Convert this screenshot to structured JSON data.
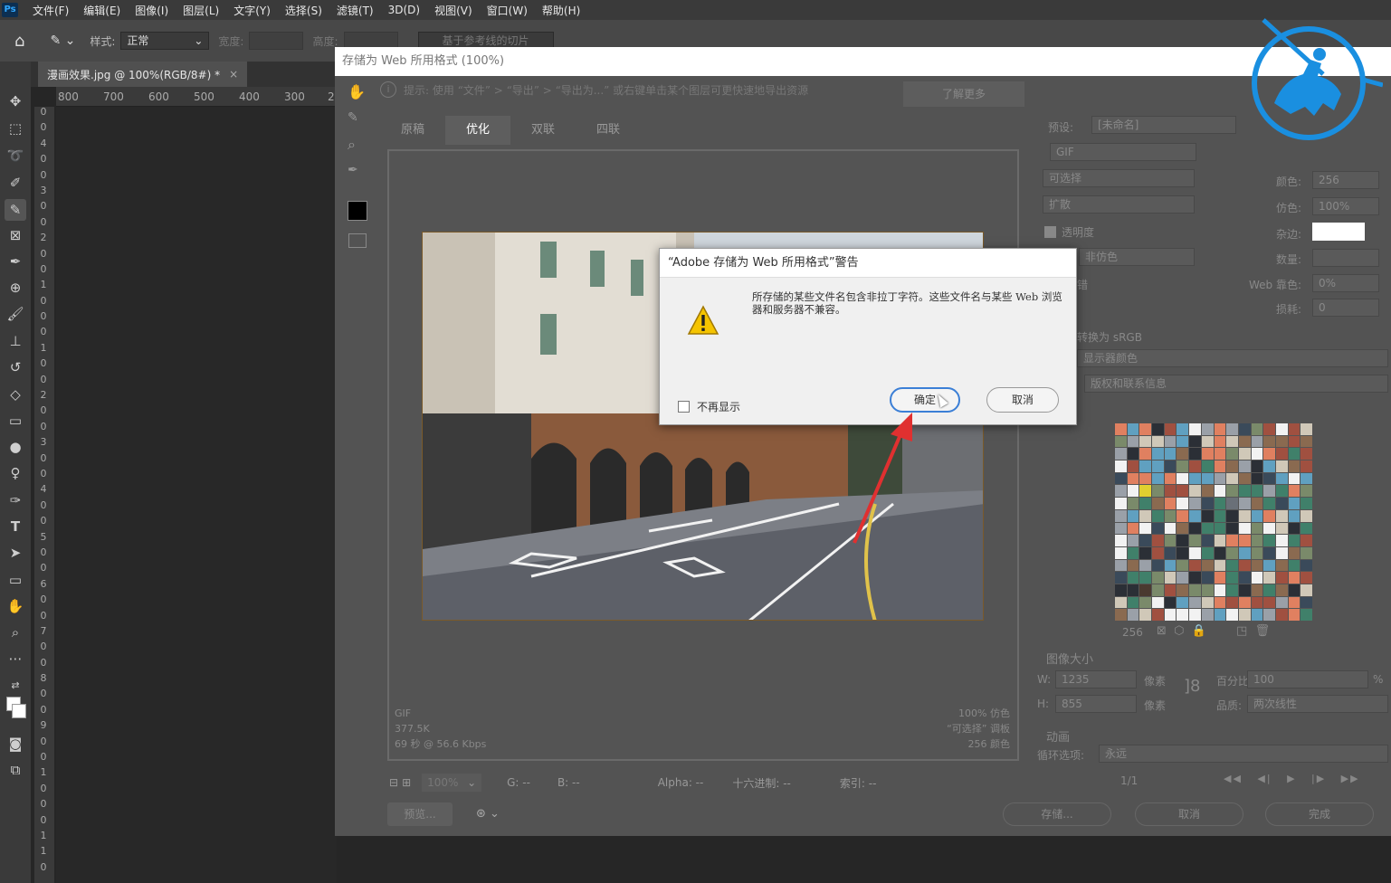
{
  "menubar": {
    "logo": "Ps",
    "items": [
      "文件(F)",
      "编辑(E)",
      "图像(I)",
      "图层(L)",
      "文字(Y)",
      "选择(S)",
      "滤镜(T)",
      "3D(D)",
      "视图(V)",
      "窗口(W)",
      "帮助(H)"
    ]
  },
  "options": {
    "style_label": "样式:",
    "style_value": "正常",
    "width_label": "宽度:",
    "height_label": "高度:",
    "slice_button": "基于参考线的切片"
  },
  "document": {
    "tab_title": "漫画效果.jpg @ 100%(RGB/8#) *",
    "close": "×",
    "ruler_h": [
      "800",
      "700",
      "600",
      "500",
      "400",
      "300",
      "2"
    ],
    "ruler_v": [
      "0",
      "0",
      "4",
      "0",
      "0",
      "3",
      "0",
      "0",
      "2",
      "0",
      "0",
      "1",
      "0",
      "0",
      "0",
      "1",
      "0",
      "0",
      "2",
      "0",
      "0",
      "3",
      "0",
      "0",
      "4",
      "0",
      "0",
      "5",
      "0",
      "0",
      "6",
      "0",
      "0",
      "7",
      "0",
      "0",
      "8",
      "0",
      "0",
      "9",
      "0",
      "0",
      "1",
      "0",
      "0",
      "0",
      "1",
      "1",
      "0"
    ]
  },
  "save_for_web": {
    "title": "存储为 Web 所用格式 (100%)",
    "hint": "提示: 使用 “文件” > “导出” > “导出为...” 或右键单击某个图层可更快速地导出资源",
    "learn_more": "了解更多",
    "tabs": [
      "原稿",
      "优化",
      "双联",
      "四联"
    ],
    "active_tab": "优化",
    "info_left": [
      "GIF",
      "377.5K",
      "69 秒 @ 56.6 Kbps"
    ],
    "info_right": [
      "100% 仿色",
      "“可选择” 调板",
      "256 颜色"
    ],
    "bottom": {
      "zoom": "100%",
      "g": "G: --",
      "b": "B: --",
      "alpha": "Alpha: --",
      "hex": "十六进制: --",
      "index": "索引: --"
    },
    "preview_button": "预览...",
    "right": {
      "preset_label": "预设:",
      "preset_value": "[未命名]",
      "format": "GIF",
      "reduction": "可选择",
      "dither_algo": "扩散",
      "transparency": "透明度",
      "matte_dither": "非仿色",
      "interlaced": "交错",
      "colors_label": "颜色:",
      "colors_value": "256",
      "dither_label": "仿色:",
      "dither_value": "100%",
      "matte_label": "杂边:",
      "amount_label": "数量:",
      "websnap_label": "Web 靠色:",
      "websnap_value": "0%",
      "lossy_label": "损耗:",
      "lossy_value": "0",
      "convert_srgb": "转换为 sRGB",
      "preview_mode": "显示器颜色",
      "metadata": "版权和联系信息",
      "palette_count": "256",
      "image_size_title": "图像大小",
      "w_label": "W:",
      "w_value": "1235",
      "h_label": "H:",
      "h_value": "855",
      "px": "像素",
      "percent_label": "百分比:",
      "percent_value": "100",
      "pct": "%",
      "quality_label": "品质:",
      "quality_value": "两次线性",
      "animation_title": "动画",
      "loop_label": "循环选项:",
      "loop_value": "永远",
      "frame": "1/1"
    },
    "buttons": {
      "save": "存储...",
      "cancel": "取消",
      "done": "完成"
    }
  },
  "alert": {
    "title": "“Adobe 存储为 Web 所用格式”警告",
    "message": "所存储的某些文件名包含非拉丁字符。这些文件名与某些 Web 浏览器和服务器不兼容。",
    "dont_show": "不再显示",
    "ok": "确定",
    "cancel": "取消"
  },
  "colors": {
    "accent": "#3b7fd6",
    "arrow": "#e03030",
    "logo": "#1a8fe0"
  }
}
